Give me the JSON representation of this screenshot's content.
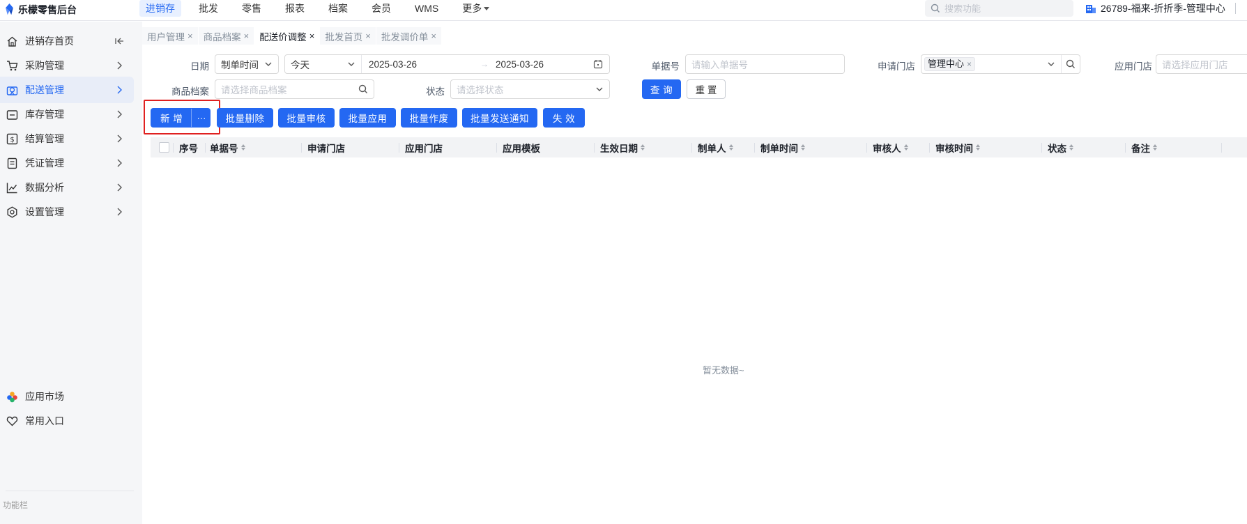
{
  "app": {
    "title": "乐檬零售后台"
  },
  "topnav": [
    {
      "label": "进销存",
      "active": true
    },
    {
      "label": "批发"
    },
    {
      "label": "零售"
    },
    {
      "label": "报表"
    },
    {
      "label": "档案"
    },
    {
      "label": "会员"
    },
    {
      "label": "WMS"
    },
    {
      "label": "更多"
    }
  ],
  "top_search": {
    "placeholder": "搜索功能"
  },
  "org": {
    "label": "26789-福来-折折季-管理中心"
  },
  "sidebar": {
    "items": [
      {
        "label": "进销存首页",
        "icon": "home-icon"
      },
      {
        "label": "采购管理",
        "icon": "cart-icon"
      },
      {
        "label": "配送管理",
        "icon": "delivery-icon",
        "active": true
      },
      {
        "label": "库存管理",
        "icon": "inventory-icon"
      },
      {
        "label": "结算管理",
        "icon": "settlement-icon"
      },
      {
        "label": "凭证管理",
        "icon": "voucher-icon"
      },
      {
        "label": "数据分析",
        "icon": "chart-icon"
      },
      {
        "label": "设置管理",
        "icon": "settings-icon"
      }
    ],
    "bottom": [
      {
        "label": "应用市场",
        "icon": "app-market-icon"
      },
      {
        "label": "常用入口",
        "icon": "heart-icon"
      }
    ],
    "footer": "功能栏"
  },
  "tabs": [
    {
      "label": "用户管理"
    },
    {
      "label": "商品档案"
    },
    {
      "label": "配送价调整",
      "active": true
    },
    {
      "label": "批发首页"
    },
    {
      "label": "批发调价单"
    }
  ],
  "filters": {
    "date_label": "日期",
    "date_type": "制单时间",
    "date_preset": "今天",
    "date_start": "2025-03-26",
    "date_end": "2025-03-26",
    "date_arrow": "→",
    "order_no_label": "单据号",
    "order_no_placeholder": "请输入单据号",
    "apply_store_label": "申请门店",
    "apply_store_tag": "管理中心",
    "target_store_label": "应用门店",
    "target_store_placeholder": "请选择应用门店",
    "product_label": "商品档案",
    "product_placeholder": "请选择商品档案",
    "status_label": "状态",
    "status_placeholder": "请选择状态",
    "query_button": "查 询",
    "reset_button": "重 置"
  },
  "actions": {
    "new_button": "新 增",
    "more_button": "···",
    "batch_delete": "批量删除",
    "batch_review": "批量审核",
    "batch_apply": "批量应用",
    "batch_void": "批量作废",
    "batch_notify": "批量发送通知",
    "invalidate": "失 效"
  },
  "table": {
    "columns": [
      {
        "label": "序号",
        "sortable": false
      },
      {
        "label": "单据号",
        "sortable": true
      },
      {
        "label": "申请门店",
        "sortable": false
      },
      {
        "label": "应用门店",
        "sortable": false
      },
      {
        "label": "应用模板",
        "sortable": false
      },
      {
        "label": "生效日期",
        "sortable": true
      },
      {
        "label": "制单人",
        "sortable": true
      },
      {
        "label": "制单时间",
        "sortable": true
      },
      {
        "label": "审核人",
        "sortable": true
      },
      {
        "label": "审核时间",
        "sortable": true
      },
      {
        "label": "状态",
        "sortable": true
      },
      {
        "label": "备注",
        "sortable": true
      }
    ],
    "rows": [],
    "empty_text": "暂无数据~"
  },
  "colors": {
    "primary": "#2468f2",
    "highlight": "#e02020"
  }
}
